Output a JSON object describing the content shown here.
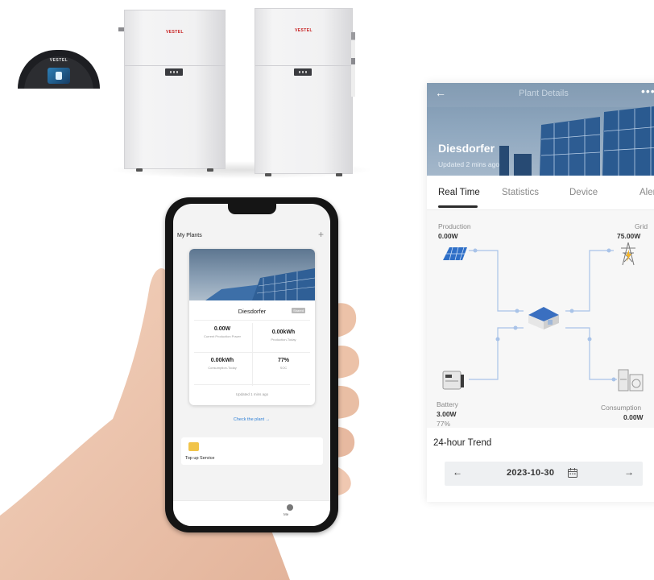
{
  "charger": {
    "brand": "VESTEL"
  },
  "inverters": [
    {
      "brand": "VESTEL"
    },
    {
      "brand": "VESTEL"
    }
  ],
  "phone": {
    "header_title": "My Plants",
    "add_icon": "plus-icon",
    "plant_card": {
      "name": "Diesdorfer",
      "shared_badge": "Shared",
      "metrics": [
        {
          "value": "0.00W",
          "label": "Current Production Power"
        },
        {
          "value": "0.00kWh",
          "label": "Production-Today"
        },
        {
          "value": "0.00kWh",
          "label": "Consumption-Today"
        },
        {
          "value": "77%",
          "label": "SOC"
        }
      ],
      "updated": "Updated 1 mins ago"
    },
    "check_link": "Check the plant →",
    "top_up": {
      "label": "Top up Service",
      "icon": "service-icon"
    },
    "tabbar": {
      "me_label": "Me"
    }
  },
  "plant_details": {
    "title": "Plant Details",
    "back_icon": "arrow-left-icon",
    "more_icon": "more-icon",
    "plant_name": "Diesdorfer",
    "updated": "Updated 2 mins ago",
    "tabs": [
      {
        "label": "Real Time",
        "active": true
      },
      {
        "label": "Statistics",
        "active": false
      },
      {
        "label": "Device",
        "active": false
      },
      {
        "label": "Aler",
        "active": false
      }
    ],
    "flow": {
      "production": {
        "label": "Production",
        "value": "0.00W"
      },
      "grid": {
        "label": "Grid",
        "value": "75.00W"
      },
      "battery": {
        "label": "Battery",
        "value": "3.00W",
        "soc": "77%"
      },
      "consumption": {
        "label": "Consumption",
        "value": "0.00W"
      }
    },
    "trend": {
      "title": "24-hour Trend",
      "date": "2023-10-30",
      "prev_icon": "arrow-left-icon",
      "next_icon": "arrow-right-icon",
      "calendar_icon": "calendar-icon"
    }
  }
}
